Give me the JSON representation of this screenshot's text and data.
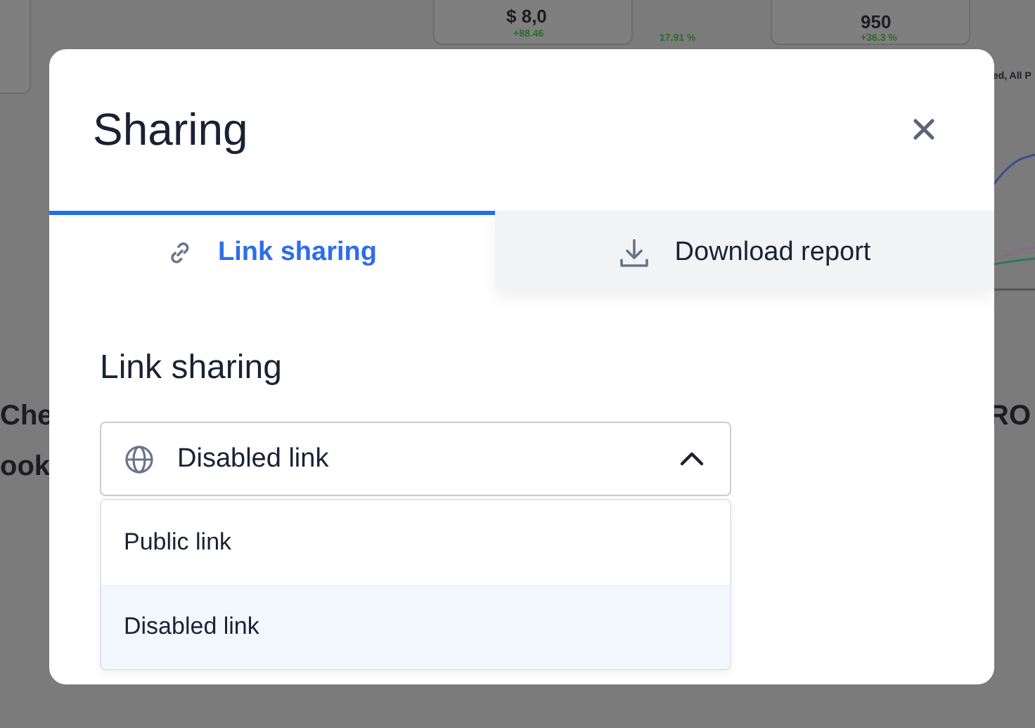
{
  "background": {
    "texts": [
      {
        "text": "$ 8,0",
        "kind": "value"
      },
      {
        "text": "+88.46",
        "kind": "delta"
      },
      {
        "text": "17.91 %",
        "kind": "delta"
      },
      {
        "text": "950",
        "kind": "value"
      },
      {
        "text": "+36.3 %",
        "kind": "delta"
      },
      {
        "text": "ed, All P",
        "kind": "small"
      },
      {
        "text": "Che",
        "kind": "heading"
      },
      {
        "text": "ook",
        "kind": "heading"
      },
      {
        "text": "RO",
        "kind": "heading"
      }
    ]
  },
  "dialog": {
    "title": "Sharing",
    "tabs": [
      {
        "label": "Link sharing",
        "selected": true
      },
      {
        "label": "Download report",
        "selected": false
      }
    ],
    "section_title": "Link sharing",
    "select": {
      "value": "Disabled link",
      "expanded": true,
      "options": [
        {
          "label": "Public link",
          "selected": false
        },
        {
          "label": "Disabled link",
          "selected": true
        }
      ]
    }
  }
}
